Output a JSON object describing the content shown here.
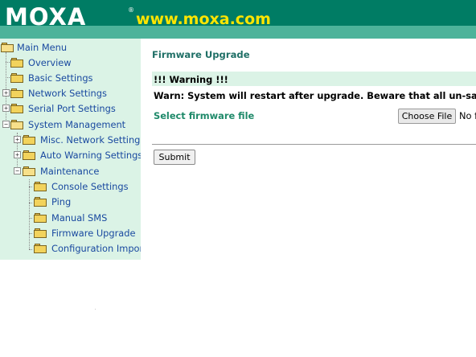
{
  "header": {
    "logo_text": "MOXA",
    "registered_mark": "®",
    "website_url": "www.moxa.com"
  },
  "sidebar": {
    "root": {
      "label": "Main Menu"
    },
    "items": [
      {
        "label": "Overview",
        "expandable": false
      },
      {
        "label": "Basic Settings",
        "expandable": false
      },
      {
        "label": "Network Settings",
        "expandable": true,
        "expanded": false
      },
      {
        "label": "Serial Port Settings",
        "expandable": true,
        "expanded": false
      },
      {
        "label": "System Management",
        "expandable": true,
        "expanded": true,
        "children": [
          {
            "label": "Misc. Network Settings",
            "expandable": true,
            "expanded": false
          },
          {
            "label": "Auto Warning Settings",
            "expandable": true,
            "expanded": false
          },
          {
            "label": "Maintenance",
            "expandable": true,
            "expanded": true,
            "children": [
              {
                "label": "Console Settings"
              },
              {
                "label": "Ping"
              },
              {
                "label": "Manual SMS"
              },
              {
                "label": "Firmware Upgrade"
              },
              {
                "label": "Configuration Import"
              }
            ]
          }
        ]
      }
    ],
    "expand_symbol": "+",
    "collapse_symbol": "−"
  },
  "main": {
    "title": "Firmware Upgrade",
    "warning": {
      "title": "!!! Warning !!!",
      "text": "Warn: System will restart after upgrade. Beware that all un-saved changes will be lost."
    },
    "firmware": {
      "label": "Select firmware file",
      "choose_button": "Choose File",
      "file_status": "No file chosen"
    },
    "submit_label": "Submit"
  },
  "colors": {
    "header_bg": "#007c64",
    "header_band": "#4db39a",
    "url_yellow": "#ffe500",
    "sidebar_bg": "#dbf3e6",
    "link_blue": "#1a4aa0",
    "title_green": "#1f6f66",
    "label_green": "#1f8a6a"
  }
}
